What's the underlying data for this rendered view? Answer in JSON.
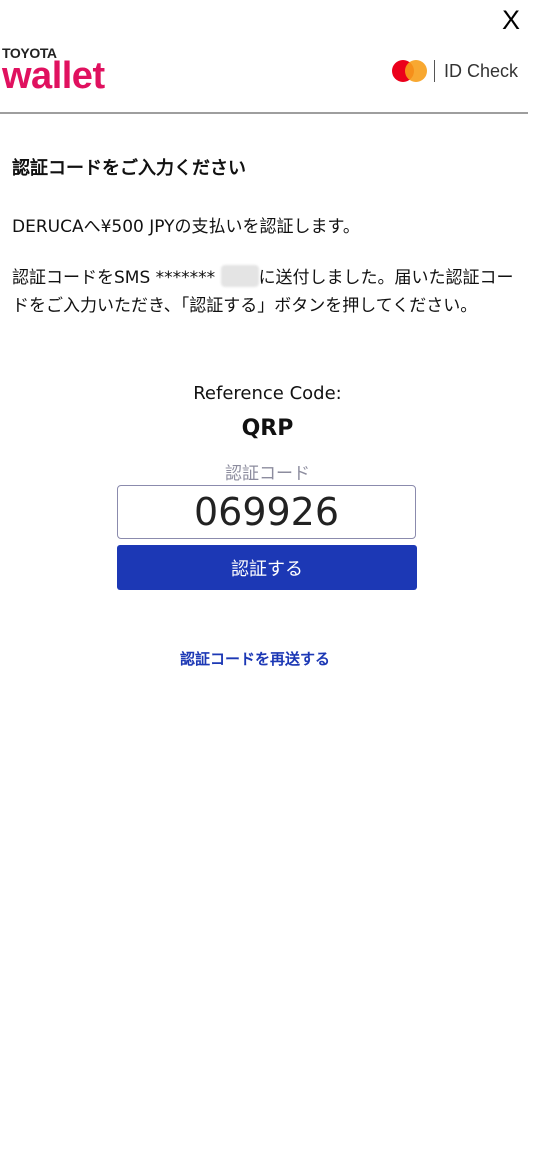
{
  "close_label": "X",
  "brand": {
    "maker": "TOYOTA",
    "product": "wallet",
    "color": "#e0115f"
  },
  "id_check": {
    "icon": "mastercard-icon",
    "label": "ID Check"
  },
  "content": {
    "title": "認証コードをご入力ください",
    "payment_text": "DERUCAへ¥500 JPYの支払いを認証します。",
    "sms_text_prefix": "認証コードをSMS *******",
    "sms_text_suffix": "に送付しました。届いた認証コードをご入力いただき、「認証する」ボタンを押してください。"
  },
  "reference": {
    "label": "Reference Code:",
    "code": "QRP"
  },
  "form": {
    "field_label": "認証コード",
    "code_value": "069926",
    "submit_label": "認証する",
    "resend_label": "認証コードを再送する"
  },
  "colors": {
    "primary_button": "#1c38b5",
    "link": "#1c38b5"
  }
}
